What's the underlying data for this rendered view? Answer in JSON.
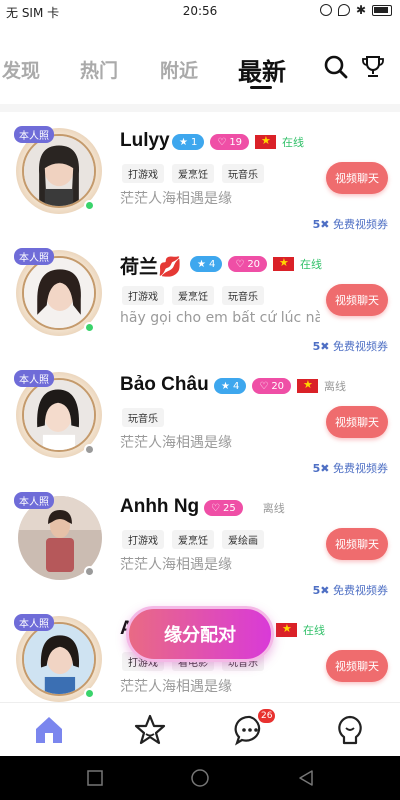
{
  "status_bar": {
    "carrier": "无 SIM 卡",
    "time": "20:56"
  },
  "tabs": [
    {
      "label": "发现"
    },
    {
      "label": "热门"
    },
    {
      "label": "附近"
    },
    {
      "label": "最新"
    }
  ],
  "badge_real": "本人照",
  "video_btn": "视频聊天",
  "voucher_count": "5",
  "voucher_text": "免费视频券",
  "users": [
    {
      "name": "Lulyy",
      "level": "1",
      "fans": "19",
      "status": "在线",
      "online": true,
      "tags": [
        "打游戏",
        "爱烹饪",
        "玩音乐"
      ],
      "sign": "茫茫人海相遇是缘"
    },
    {
      "name": "荷兰💋",
      "level": "4",
      "fans": "20",
      "status": "在线",
      "online": true,
      "tags": [
        "打游戏",
        "爱烹饪",
        "玩音乐"
      ],
      "sign": "hãy gọi cho em bất cứ lúc nà..."
    },
    {
      "name": "Bảo  Châu",
      "level": "4",
      "fans": "20",
      "status": "离线",
      "online": false,
      "tags": [
        "玩音乐"
      ],
      "sign": "茫茫人海相遇是缘"
    },
    {
      "name": "Anhh Ng",
      "fans": "25",
      "status": "离线",
      "online": false,
      "tags": [
        "打游戏",
        "爱烹饪",
        "爱绘画"
      ],
      "sign": "茫茫人海相遇是缘"
    },
    {
      "name": "A",
      "status": "在线",
      "online": true,
      "tags": [
        "打游戏",
        "看电影",
        "玩音乐"
      ],
      "sign": "茫茫人海相遇是缘"
    }
  ],
  "match_btn": "缘分配对",
  "bottom_nav": {
    "messages_badge": "26"
  },
  "colors": {
    "accent": "#ef6c6e",
    "online": "#3ad36b",
    "voucher": "#4e6fc4"
  }
}
